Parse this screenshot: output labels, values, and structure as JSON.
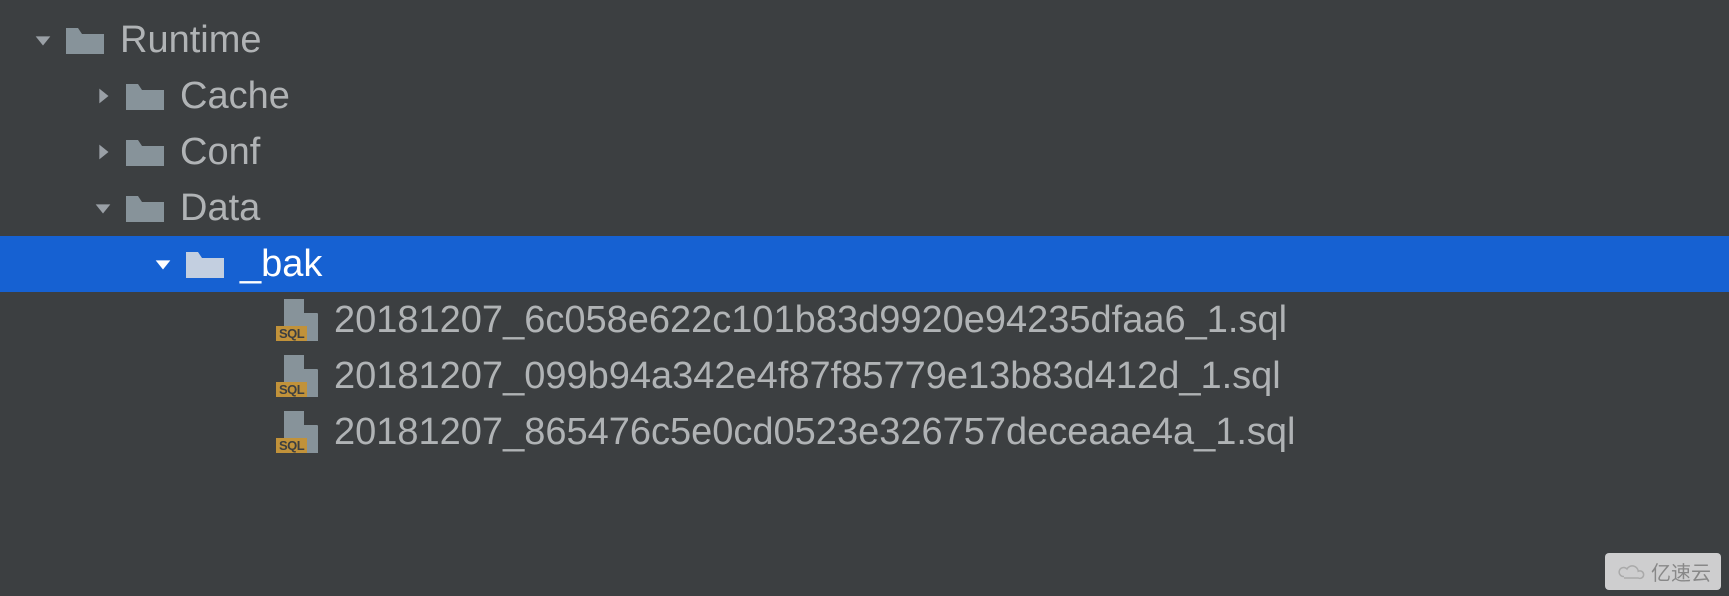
{
  "tree": {
    "root": {
      "name": "Runtime",
      "expanded": true,
      "children": [
        {
          "name": "Cache",
          "expanded": false
        },
        {
          "name": "Conf",
          "expanded": false
        },
        {
          "name": "Data",
          "expanded": true,
          "children": [
            {
              "name": "_bak",
              "expanded": true,
              "selected": true,
              "files": [
                "20181207_6c058e622c101b83d9920e94235dfaa6_1.sql",
                "20181207_099b94a342e4f87f85779e13b83d412d_1.sql",
                "20181207_865476c5e0cd0523e326757deceaae4a_1.sql"
              ]
            }
          ]
        }
      ]
    }
  },
  "sql_badge": "SQL",
  "watermark": "亿速云"
}
